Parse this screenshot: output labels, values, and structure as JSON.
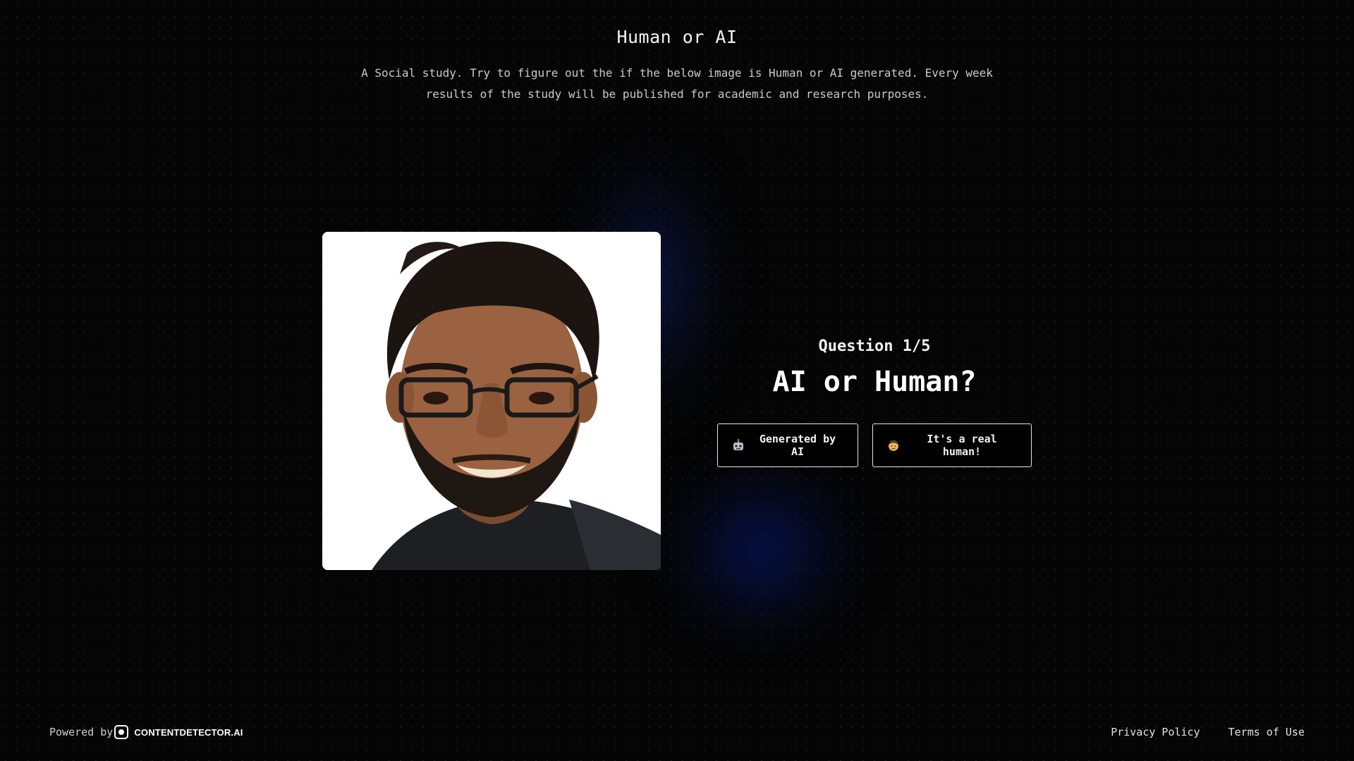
{
  "header": {
    "title": "Human or AI",
    "subtitle": "A Social study. Try to figure out the if the below image is Human or AI generated. Every week results of the study will be published for academic and research purposes."
  },
  "photo": {
    "alt": "portrait"
  },
  "quiz": {
    "counter": "Question 1/5",
    "title": "AI or Human?",
    "buttons": {
      "ai_icon": "robot-icon",
      "ai_label": "Generated by AI",
      "human_icon": "man-icon",
      "human_label": "It's a real human!"
    }
  },
  "footer": {
    "powered_by": "Powered by",
    "brand": "CONTENTDETECTOR.AI",
    "links": [
      "Privacy Policy",
      "Terms of Use"
    ]
  },
  "colors": {
    "background": "#050505",
    "glow": "#0a1e8c",
    "button_border": "#e6e6e6",
    "text": "#f2f2f2"
  }
}
